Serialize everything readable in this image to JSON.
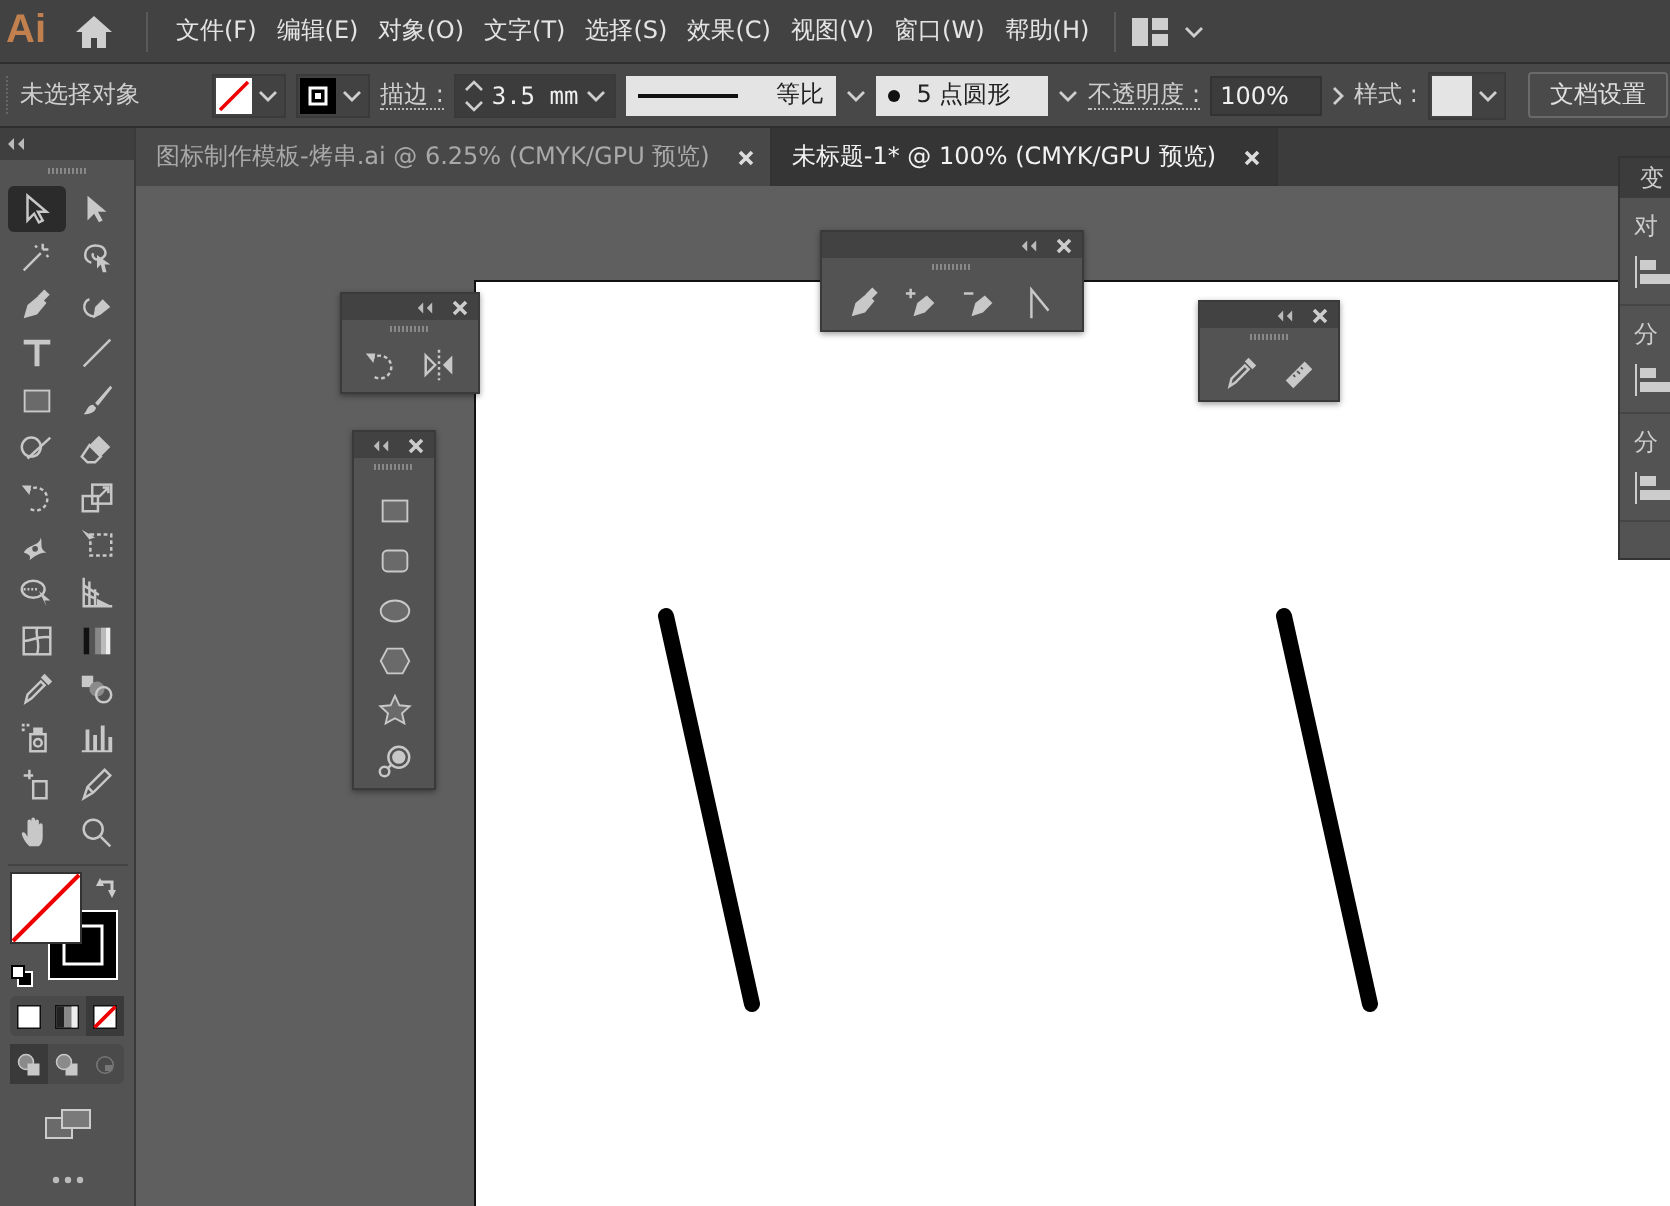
{
  "menu_bar": {
    "logo": "Ai",
    "menus": [
      "文件(F)",
      "编辑(E)",
      "对象(O)",
      "文字(T)",
      "选择(S)",
      "效果(C)",
      "视图(V)",
      "窗口(W)",
      "帮助(H)"
    ]
  },
  "control_bar": {
    "selection_label": "未选择对象",
    "stroke_label": "描边 :",
    "stroke_value": "3.5 mm",
    "stroke_profile": "等比",
    "brush": "5 点圆形",
    "opacity_label": "不透明度 :",
    "opacity_value": "100%",
    "style_label": "样式 :",
    "document_setup": "文档设置"
  },
  "tabs": [
    {
      "label": "图标制作模板-烤串.ai @ 6.25% (CMYK/GPU 预览)",
      "selected": false
    },
    {
      "label": "未标题-1* @ 100% (CMYK/GPU 预览)",
      "selected": true
    }
  ],
  "toolbar": {
    "tools": [
      {
        "kind": "selection",
        "selected": true
      },
      {
        "kind": "direct",
        "selected": false
      },
      {
        "kind": "wand",
        "selected": false
      },
      {
        "kind": "lasso",
        "selected": false
      },
      {
        "kind": "pen",
        "selected": false
      },
      {
        "kind": "curvature",
        "selected": false
      },
      {
        "kind": "type",
        "selected": false
      },
      {
        "kind": "line",
        "selected": false
      },
      {
        "kind": "rect",
        "selected": false
      },
      {
        "kind": "brush",
        "selected": false
      },
      {
        "kind": "shaper",
        "selected": false
      },
      {
        "kind": "eraser",
        "selected": false
      },
      {
        "kind": "rotate",
        "selected": false
      },
      {
        "kind": "scale",
        "selected": false
      },
      {
        "kind": "puppet",
        "selected": false
      },
      {
        "kind": "freetransform",
        "selected": false
      },
      {
        "kind": "shapebuilder",
        "selected": false
      },
      {
        "kind": "perspective",
        "selected": false
      },
      {
        "kind": "mesh",
        "selected": false
      },
      {
        "kind": "gradient",
        "selected": false
      },
      {
        "kind": "eyedropper",
        "selected": false
      },
      {
        "kind": "blend",
        "selected": false
      },
      {
        "kind": "sprayer",
        "selected": false
      },
      {
        "kind": "graph",
        "selected": false
      },
      {
        "kind": "artboard",
        "selected": false
      },
      {
        "kind": "pencil",
        "selected": false
      },
      {
        "kind": "hand",
        "selected": false
      },
      {
        "kind": "zoom",
        "selected": false
      }
    ],
    "color_modes": [
      {
        "kind": "color",
        "selected": false
      },
      {
        "kind": "gradient",
        "selected": false
      },
      {
        "kind": "none",
        "selected": true
      }
    ],
    "draw_modes": [
      {
        "kind": "normal",
        "selected": true
      },
      {
        "kind": "behind",
        "selected": false
      },
      {
        "kind": "inside",
        "selected": false
      }
    ]
  },
  "floating_panels": [
    {
      "tools": [
        {
          "kind": "rotate"
        },
        {
          "kind": "reflect"
        }
      ]
    },
    {
      "tools": [
        {
          "kind": "rect"
        },
        {
          "kind": "roundrect"
        },
        {
          "kind": "ellipse"
        },
        {
          "kind": "polygon"
        },
        {
          "kind": "star"
        },
        {
          "kind": "flare"
        }
      ]
    },
    {
      "tools": [
        {
          "kind": "pen"
        },
        {
          "kind": "addanchor"
        },
        {
          "kind": "delanchor"
        },
        {
          "kind": "anchor"
        }
      ]
    },
    {
      "tools": [
        {
          "kind": "eyedropper"
        },
        {
          "kind": "measure"
        }
      ]
    }
  ],
  "right_panel": {
    "title": "变",
    "sections": [
      {
        "label": "对"
      },
      {
        "label": "分"
      },
      {
        "label": "分"
      }
    ]
  }
}
